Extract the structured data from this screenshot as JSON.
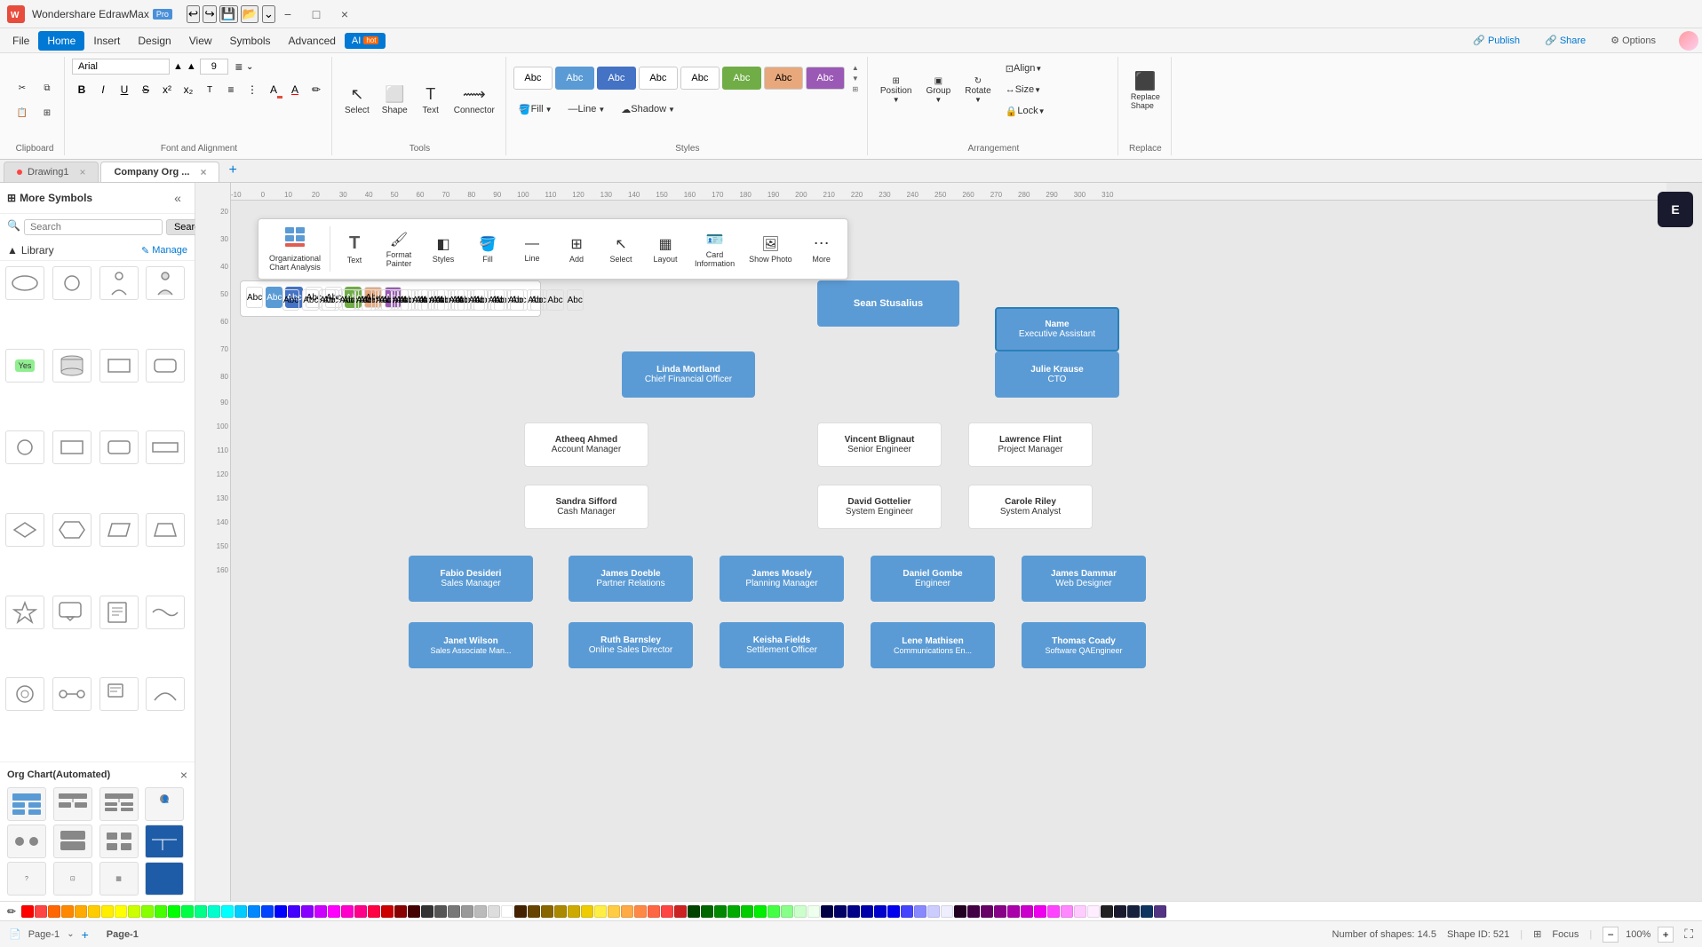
{
  "app": {
    "title": "Wondershare EdrawMax",
    "pro_badge": "Pro"
  },
  "titlebar": {
    "undo_tooltip": "Undo",
    "redo_tooltip": "Redo",
    "save_tooltip": "Save",
    "open_tooltip": "Open",
    "win_minimize": "−",
    "win_maximize": "□",
    "win_close": "×"
  },
  "menubar": {
    "items": [
      "File",
      "Home",
      "Insert",
      "Design",
      "View",
      "Symbols",
      "Advanced"
    ],
    "active": "Home",
    "ai_label": "AI",
    "ai_hot": "hot",
    "publish_label": "Publish",
    "share_label": "Share",
    "options_label": "Options"
  },
  "ribbon": {
    "clipboard_label": "Clipboard",
    "font_label": "Font and Alignment",
    "tools_label": "Tools",
    "styles_label": "Styles",
    "arrangement_label": "Arrangement",
    "replace_label": "Replace",
    "font_family": "Arial",
    "font_size": "9",
    "bold": "B",
    "italic": "I",
    "underline": "U",
    "strikethrough": "S",
    "superscript": "x²",
    "subscript": "x₂",
    "clear_format": "T",
    "text_color": "A",
    "select_label": "Select",
    "shape_label": "Shape",
    "text_label": "Text",
    "connector_label": "Connector",
    "fill_label": "Fill",
    "line_label": "Line",
    "shadow_label": "Shadow",
    "position_label": "Position",
    "group_label": "Group",
    "rotate_label": "Rotate",
    "align_label": "Align",
    "size_label": "Size",
    "lock_label": "Lock",
    "replace_shape_label": "Replace Shape",
    "line_shadow_label": "Line Shadow",
    "styles": [
      "Abc",
      "Abc",
      "Abc",
      "Abc",
      "Abc",
      "Abc",
      "Abc",
      "Abc"
    ]
  },
  "sidebar": {
    "more_symbols_label": "More Symbols",
    "search_placeholder": "Search",
    "search_button_label": "Search",
    "library_label": "Library",
    "manage_label": "Manage"
  },
  "org_panel": {
    "title": "Org Chart(Automated)",
    "close_tooltip": "Close"
  },
  "tabs": [
    {
      "id": "drawing1",
      "label": "Drawing1",
      "has_dot": true
    },
    {
      "id": "company_org",
      "label": "Company Org ...",
      "active": true
    }
  ],
  "context_toolbar": {
    "buttons": [
      {
        "id": "org-analysis",
        "icon": "📊",
        "label": "Organizational\nChart Analysis"
      },
      {
        "id": "text",
        "icon": "T",
        "label": "Text"
      },
      {
        "id": "format-painter",
        "icon": "🖌",
        "label": "Format\nPainter"
      },
      {
        "id": "styles",
        "icon": "◧",
        "label": "Styles"
      },
      {
        "id": "fill",
        "icon": "🪣",
        "label": "Fill"
      },
      {
        "id": "line",
        "icon": "—",
        "label": "Line"
      },
      {
        "id": "add",
        "icon": "⊞",
        "label": "Add"
      },
      {
        "id": "select",
        "icon": "↖",
        "label": "Select"
      },
      {
        "id": "layout",
        "icon": "▦",
        "label": "Layout"
      },
      {
        "id": "card-info",
        "icon": "🪪",
        "label": "Card\nInformation"
      },
      {
        "id": "show-photo",
        "icon": "🖼",
        "label": "Show Photo"
      },
      {
        "id": "more",
        "icon": "⋯",
        "label": "More"
      }
    ]
  },
  "org_chart": {
    "ceo": {
      "name": "Sean Stusalius",
      "title": ""
    },
    "exec_asst": {
      "name": "Name",
      "title": "Executive Assistant"
    },
    "cfo": {
      "name": "Linda Mortland",
      "title": "Chief Financial Officer"
    },
    "cto": {
      "name": "Julie Krause",
      "title": "CTO"
    },
    "reports": [
      {
        "name": "Atheeq Ahmed",
        "title": "Account Manager"
      },
      {
        "name": "Vincent Blignaut",
        "title": "Senior Engineer"
      },
      {
        "name": "Lawrence Flint",
        "title": "Project Manager"
      },
      {
        "name": "Sandra Sifford",
        "title": "Cash Manager"
      },
      {
        "name": "David Gottelier",
        "title": "System Engineer"
      },
      {
        "name": "Carole Riley",
        "title": "System Analyst"
      },
      {
        "name": "Fabio Desideri",
        "title": "Sales Manager"
      },
      {
        "name": "James Doeble",
        "title": "Partner Relations"
      },
      {
        "name": "James Mosely",
        "title": "Planning Manager"
      },
      {
        "name": "Daniel Gombe",
        "title": "Engineer"
      },
      {
        "name": "James Dammar",
        "title": "Web Designer"
      },
      {
        "name": "Janet Wilson",
        "title": "Sales Associate Man..."
      },
      {
        "name": "Ruth Barnsley",
        "title": "Online Sales Director"
      },
      {
        "name": "Keisha Fields",
        "title": "Settlement Officer"
      },
      {
        "name": "Lene Mathisen",
        "title": "Communications En..."
      },
      {
        "name": "Thomas Coady",
        "title": "Software QAEngineer"
      }
    ]
  },
  "statusbar": {
    "page_label": "Page-1",
    "shapes_label": "Number of shapes: 14.5",
    "shape_id_label": "Shape ID: 521",
    "focus_label": "Focus",
    "zoom_value": "100%",
    "fullscreen_tooltip": "Fullscreen"
  },
  "palette_colors": [
    "#FF0000",
    "#FF4444",
    "#FF6600",
    "#FF8800",
    "#FFAA00",
    "#FFCC00",
    "#FFEE00",
    "#FFFF00",
    "#CCFF00",
    "#88FF00",
    "#44FF00",
    "#00FF00",
    "#00FF44",
    "#00FF88",
    "#00FFCC",
    "#00FFFF",
    "#00CCFF",
    "#0088FF",
    "#0044FF",
    "#0000FF",
    "#4400FF",
    "#8800FF",
    "#CC00FF",
    "#FF00FF",
    "#FF00CC",
    "#FF0088",
    "#FF0044",
    "#CC0000",
    "#880000",
    "#440000",
    "#333333",
    "#555555",
    "#777777",
    "#999999",
    "#BBBBBB",
    "#DDDDDD",
    "#FFFFFF",
    "#442200",
    "#664400",
    "#886600",
    "#AA8800",
    "#CCAA00",
    "#EECC00",
    "#FFEE44",
    "#FFCC44",
    "#FFAA44",
    "#FF8844",
    "#FF6644",
    "#FF4444",
    "#CC2222",
    "#004400",
    "#006600",
    "#008800",
    "#00AA00",
    "#00CC00",
    "#00EE00",
    "#44FF44",
    "#88FF88",
    "#CCFFCC",
    "#EEFFEE",
    "#000044",
    "#000066",
    "#000088",
    "#0000AA",
    "#0000CC",
    "#0000EE",
    "#4444FF",
    "#8888FF",
    "#CCCCFF",
    "#EEEEFF",
    "#220022",
    "#440044",
    "#660066",
    "#880088",
    "#AA00AA",
    "#CC00CC",
    "#EE00EE",
    "#FF44FF",
    "#FF88FF",
    "#FFCCFF",
    "#FFEEFF",
    "#222222",
    "#1a1a2e",
    "#16213e",
    "#0f3460",
    "#533483"
  ]
}
